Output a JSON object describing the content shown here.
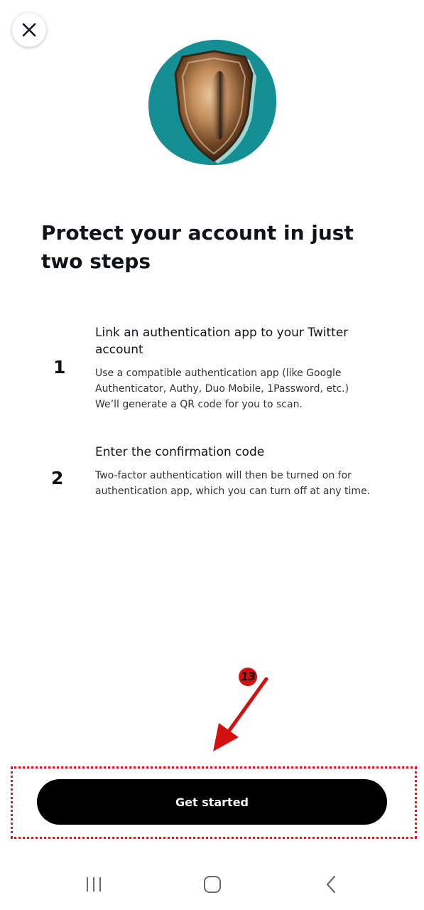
{
  "header": {
    "close_icon": "close-icon",
    "hero_icon": "shield-icon"
  },
  "title": "Protect your account in just two steps",
  "steps": [
    {
      "number": "1",
      "title": "Link an authentication app to your Twitter account",
      "description": "Use a compatible authentication app (like Google Authenticator, Authy, Duo Mobile, 1Password, etc.) We’ll generate a QR code for you to scan."
    },
    {
      "number": "2",
      "title": "Enter the confirmation code",
      "description": "Two-factor authentication will then be turned on for authentication app, which you can turn off at any time."
    }
  ],
  "cta": {
    "label": "Get started"
  },
  "annotation": {
    "marker_label": "13",
    "highlight_color": "#e0141e"
  },
  "system_nav": {
    "recents_icon": "recents-icon",
    "home_icon": "home-icon",
    "back_icon": "back-icon"
  },
  "colors": {
    "text": "#0f1419",
    "button_bg": "#000000",
    "button_text": "#ffffff",
    "hero_teal": "#158f93",
    "shield_bronze": "#b8865a"
  }
}
